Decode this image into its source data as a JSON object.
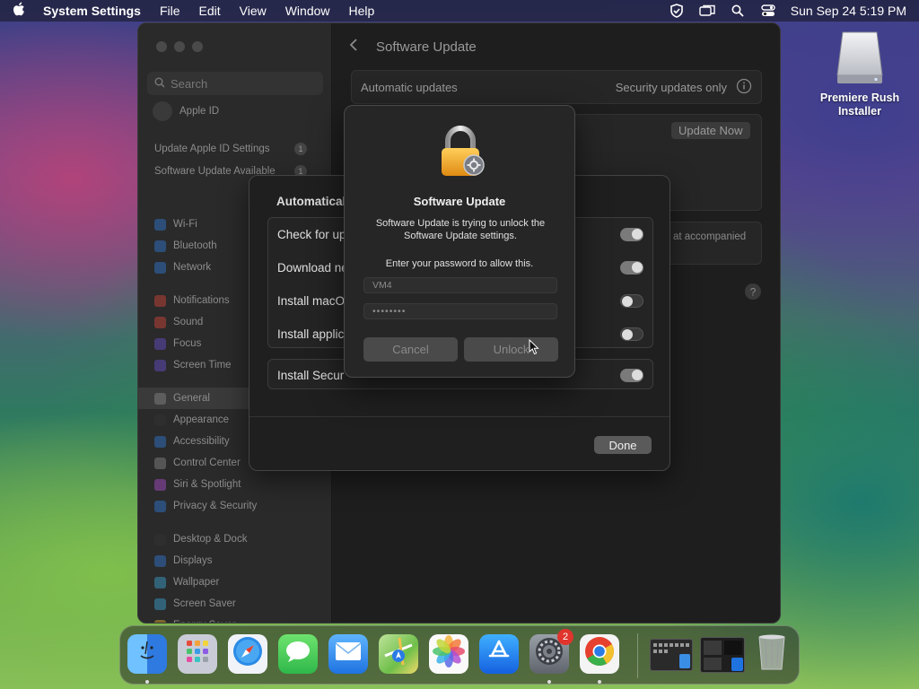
{
  "menubar": {
    "app_name": "System Settings",
    "menus": [
      "File",
      "Edit",
      "View",
      "Window",
      "Help"
    ],
    "clock": "Sun Sep 24  5:19 PM"
  },
  "settings": {
    "search_placeholder": "Search",
    "sidebar_top": [
      {
        "label": "Apple ID"
      },
      {
        "label": "Update Apple ID Settings",
        "badge": "1"
      },
      {
        "label": "Software Update Available",
        "badge": "1"
      }
    ],
    "sidebar_items": [
      {
        "label": "Wi-Fi",
        "color": "#2f7bd8"
      },
      {
        "label": "Bluetooth",
        "color": "#2f7bd8"
      },
      {
        "label": "Network",
        "color": "#2f7bd8"
      },
      {
        "label": "Notifications",
        "color": "#d8453a"
      },
      {
        "label": "Sound",
        "color": "#d8453a"
      },
      {
        "label": "Focus",
        "color": "#6a4fd0"
      },
      {
        "label": "Screen Time",
        "color": "#6a4fd0"
      },
      {
        "label": "General",
        "color": "#8a8a8a"
      },
      {
        "label": "Appearance",
        "color": "#333333"
      },
      {
        "label": "Accessibility",
        "color": "#2f7bd8"
      },
      {
        "label": "Control Center",
        "color": "#8a8a8a"
      },
      {
        "label": "Siri & Spotlight",
        "color": "#b04fd0"
      },
      {
        "label": "Privacy & Security",
        "color": "#2f7bd8"
      },
      {
        "label": "Desktop & Dock",
        "color": "#333333"
      },
      {
        "label": "Displays",
        "color": "#2f7bd8"
      },
      {
        "label": "Wallpaper",
        "color": "#3aa7d8"
      },
      {
        "label": "Screen Saver",
        "color": "#3aa7d8"
      },
      {
        "label": "Energy Saver",
        "color": "#e0b030"
      }
    ],
    "content_title": "Software Update",
    "automatic_updates_label": "Automatic updates",
    "automatic_updates_value": "Security updates only",
    "update_now": "Update Now",
    "accompanied_text": "at accompanied"
  },
  "sheet": {
    "title": "Automatical",
    "options": [
      {
        "label": "Check for up",
        "on": true
      },
      {
        "label": "Download ne",
        "on": true
      },
      {
        "label": "Install macO",
        "on": false
      },
      {
        "label": "Install applic",
        "on": false
      }
    ],
    "security_option": {
      "label": "Install Secur",
      "on": true
    },
    "done": "Done"
  },
  "auth": {
    "title": "Software Update",
    "message": "Software Update is trying to unlock the Software Update settings.",
    "prompt": "Enter your password to allow this.",
    "username": "VM4",
    "password_mask": "••••••••",
    "cancel": "Cancel",
    "unlock": "Unlock"
  },
  "desktop_icon": {
    "label": "Premiere Rush Installer"
  },
  "dock": {
    "apps": [
      {
        "name": "Finder",
        "icon": "finder-icon",
        "color": "#3a8ee6"
      },
      {
        "name": "Launchpad",
        "icon": "launchpad-icon",
        "color": "#c9ccd6"
      },
      {
        "name": "Safari",
        "icon": "safari-icon",
        "color": "#2a8be6"
      },
      {
        "name": "Messages",
        "icon": "messages-icon",
        "color": "#3ac356"
      },
      {
        "name": "Mail",
        "icon": "mail-icon",
        "color": "#3a8ee6"
      },
      {
        "name": "Maps",
        "icon": "maps-icon",
        "color": "#6fbf4a"
      },
      {
        "name": "Photos",
        "icon": "photos-icon",
        "color": "#f2f2f2"
      },
      {
        "name": "App Store",
        "icon": "app-store-icon",
        "color": "#1f7ae6"
      },
      {
        "name": "System Settings",
        "icon": "system-settings-icon",
        "color": "#8a8a8a",
        "badge": "2"
      },
      {
        "name": "Chrome",
        "icon": "chrome-icon",
        "color": "#f2f2f2"
      }
    ]
  }
}
